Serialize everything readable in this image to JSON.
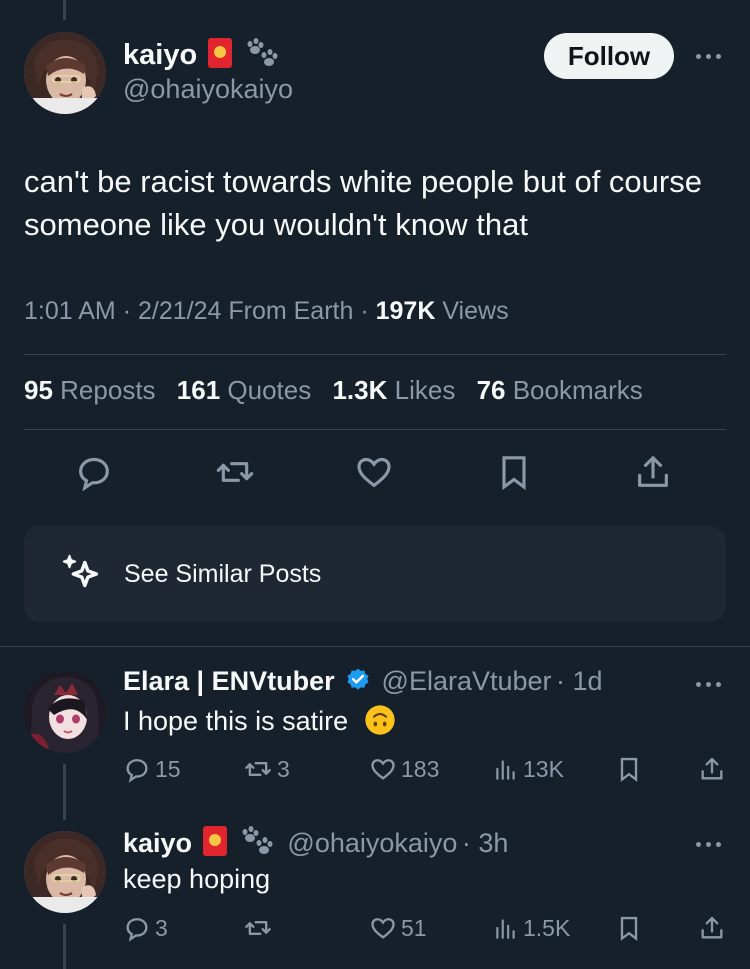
{
  "main_tweet": {
    "author": {
      "name": "kaiyo",
      "handle": "@ohaiyokaiyo"
    },
    "follow_label": "Follow",
    "text": "can't be racist towards white people but of course someone like you wouldn't know that",
    "meta": {
      "time": "1:01 AM",
      "sep1": "·",
      "date": "2/21/24",
      "source": "From Earth",
      "sep2": "·",
      "views_count": "197K",
      "views_label": "Views"
    },
    "stats": [
      {
        "count": "95",
        "label": "Reposts"
      },
      {
        "count": "161",
        "label": "Quotes"
      },
      {
        "count": "1.3K",
        "label": "Likes"
      },
      {
        "count": "76",
        "label": "Bookmarks"
      }
    ],
    "actions": [
      "reply-icon",
      "repost-icon",
      "like-icon",
      "bookmark-icon",
      "share-icon"
    ],
    "similar_label": "See Similar Posts"
  },
  "replies": [
    {
      "name": "Elara | ENVtuber",
      "verified": true,
      "handle": "@ElaraVtuber",
      "time": "· 1d",
      "text": "I hope this is satire",
      "counts": {
        "replies": "15",
        "reposts": "3",
        "likes": "183",
        "views": "13K"
      }
    },
    {
      "name": "kaiyo",
      "verified": false,
      "handle": "@ohaiyokaiyo",
      "time": "· 3h",
      "text": "keep hoping",
      "counts": {
        "replies": "3",
        "reposts": "",
        "likes": "51",
        "views": "1.5K"
      }
    }
  ],
  "colors": {
    "background": "#15202b",
    "text": "#f7f9f9",
    "muted": "#8b98a5",
    "divider": "#38444d",
    "verified": "#1d9bf0",
    "card": "#1e2732"
  }
}
